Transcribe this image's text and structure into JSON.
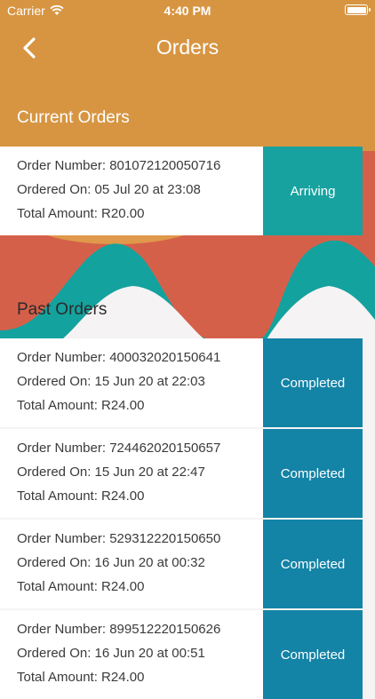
{
  "status_bar": {
    "carrier": "Carrier",
    "time": "4:40 PM"
  },
  "nav": {
    "title": "Orders",
    "back_icon": "chevron-left-icon"
  },
  "colors": {
    "header": "#d79542",
    "red": "#d5604a",
    "teal": "#14a29e",
    "blue": "#1383a6",
    "background": "#f5f3f4"
  },
  "sections": {
    "current_title": "Current Orders",
    "past_title": "Past Orders"
  },
  "current_orders": [
    {
      "number": "Order Number: 801072120050716",
      "date": "Ordered On: 05 Jul 20 at 23:08",
      "amount": "Total Amount: R20.00",
      "status": "Arriving"
    }
  ],
  "past_orders": [
    {
      "number": "Order Number: 400032020150641",
      "date": "Ordered On: 15 Jun 20 at 22:03",
      "amount": "Total Amount: R24.00",
      "status": "Completed"
    },
    {
      "number": "Order Number: 724462020150657",
      "date": "Ordered On: 15 Jun 20 at 22:47",
      "amount": "Total Amount: R24.00",
      "status": "Completed"
    },
    {
      "number": "Order Number: 529312220150650",
      "date": "Ordered On: 16 Jun 20 at 00:32",
      "amount": "Total Amount: R24.00",
      "status": "Completed"
    },
    {
      "number": "Order Number: 899512220150626",
      "date": "Ordered On: 16 Jun 20 at 00:51",
      "amount": "Total Amount: R24.00",
      "status": "Completed"
    }
  ]
}
